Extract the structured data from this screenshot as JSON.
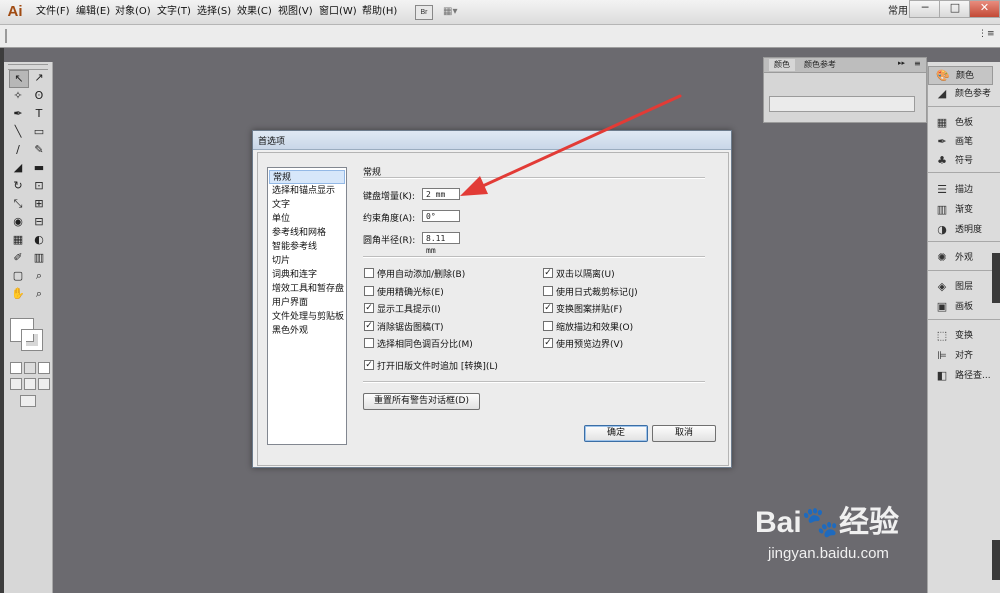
{
  "app": {
    "logo": "Ai",
    "menus": [
      "文件(F)",
      "编辑(E)",
      "对象(O)",
      "文字(T)",
      "选择(S)",
      "效果(C)",
      "视图(V)",
      "窗口(W)",
      "帮助(H)"
    ],
    "bridge_label": "Br",
    "workspace": "常用",
    "window_buttons": [
      "─",
      "□",
      "✕"
    ],
    "control_menu_glyph": "⋮≡"
  },
  "tools": [
    "↖",
    "↗",
    "✧",
    "ʘ",
    "✒",
    "T",
    "╲",
    "▭",
    "∕",
    "✎",
    "◢",
    "▬",
    "↻",
    "⊡",
    "⤡",
    "⊞",
    "◉",
    "⊟",
    "▦",
    "◐",
    "✐",
    "▥",
    "▢",
    "⌕",
    "✋",
    "⌕"
  ],
  "color_panel": {
    "tabs": [
      "颜色",
      "颜色参考"
    ],
    "controls": "▸▸",
    "menu": "≡"
  },
  "dock": {
    "items": [
      {
        "icon": "🎨",
        "label": "颜色"
      },
      {
        "icon": "◢",
        "label": "颜色参考"
      },
      {
        "icon": "▦",
        "label": "色板"
      },
      {
        "icon": "✒",
        "label": "画笔"
      },
      {
        "icon": "♣",
        "label": "符号"
      },
      {
        "icon": "☰",
        "label": "描边"
      },
      {
        "icon": "▥",
        "label": "渐变"
      },
      {
        "icon": "◑",
        "label": "透明度"
      },
      {
        "icon": "✺",
        "label": "外观"
      },
      {
        "icon": "◈",
        "label": "图层"
      },
      {
        "icon": "▣",
        "label": "画板"
      },
      {
        "icon": "⬚",
        "label": "变换"
      },
      {
        "icon": "⊫",
        "label": "对齐"
      },
      {
        "icon": "◧",
        "label": "路径查..."
      }
    ]
  },
  "dialog": {
    "title": "首选项",
    "nav": [
      "常规",
      "选择和锚点显示",
      "文字",
      "单位",
      "参考线和网格",
      "智能参考线",
      "切片",
      "词典和连字",
      "增效工具和暂存盘",
      "用户界面",
      "文件处理与剪贴板",
      "黑色外观"
    ],
    "section_title": "常规",
    "fields": [
      {
        "label": "键盘增量(K):",
        "value": "2 mm"
      },
      {
        "label": "约束角度(A):",
        "value": "0°"
      },
      {
        "label": "圆角半径(R):",
        "value": "8.11 mm"
      }
    ],
    "options_left": [
      {
        "label": "停用自动添加/删除(B)",
        "checked": false
      },
      {
        "label": "使用精确光标(E)",
        "checked": false
      },
      {
        "label": "显示工具提示(I)",
        "checked": true
      },
      {
        "label": "消除锯齿图稿(T)",
        "checked": true
      },
      {
        "label": "选择相同色调百分比(M)",
        "checked": false
      },
      {
        "label": "打开旧版文件时追加 [转换](L)",
        "checked": true
      }
    ],
    "options_right": [
      {
        "label": "双击以隔离(U)",
        "checked": true
      },
      {
        "label": "使用日式裁剪标记(J)",
        "checked": false
      },
      {
        "label": "变换图案拼贴(F)",
        "checked": true
      },
      {
        "label": "缩放描边和效果(O)",
        "checked": false
      },
      {
        "label": "使用预览边界(V)",
        "checked": true
      }
    ],
    "reset_button": "重置所有警告对话框(D)",
    "ok_button": "确定",
    "cancel_button": "取消"
  },
  "watermark": {
    "brand": "Bai🐾经验",
    "url": "jingyan.baidu.com"
  },
  "colors": {
    "canvas_bg": "#6b6a6f",
    "annotation_arrow": "#e23b36"
  }
}
